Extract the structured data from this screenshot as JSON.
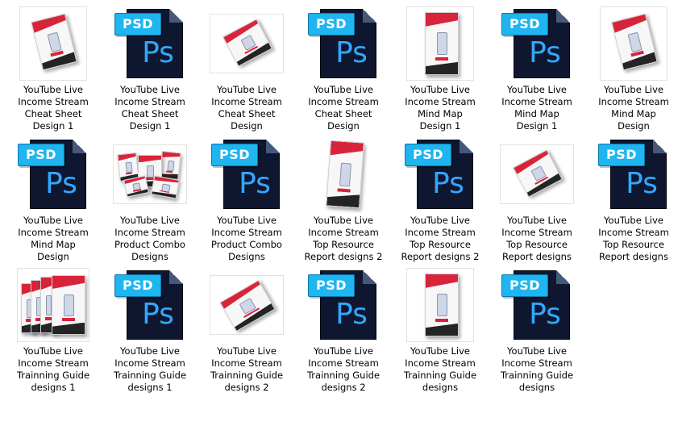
{
  "files": [
    {
      "type": "cover",
      "style": "tilt",
      "label": [
        "YouTube Live",
        "Income Stream",
        "Cheat Sheet",
        "Design 1"
      ]
    },
    {
      "type": "psd",
      "badge": "PSD",
      "mark": "Ps",
      "label": [
        "YouTube Live",
        "Income Stream",
        "Cheat Sheet",
        "Design 1"
      ]
    },
    {
      "type": "cover",
      "style": "flat",
      "label": [
        "YouTube Live",
        "Income Stream",
        "Cheat Sheet",
        "Design"
      ]
    },
    {
      "type": "psd",
      "badge": "PSD",
      "mark": "Ps",
      "label": [
        "YouTube Live",
        "Income Stream",
        "Cheat Sheet",
        "Design"
      ]
    },
    {
      "type": "cover",
      "style": "book",
      "label": [
        "YouTube Live",
        "Income Stream",
        "Mind Map",
        "Design 1"
      ]
    },
    {
      "type": "psd",
      "badge": "PSD",
      "mark": "Ps",
      "label": [
        "YouTube Live",
        "Income Stream",
        "Mind Map",
        "Design 1"
      ]
    },
    {
      "type": "cover",
      "style": "tilt",
      "label": [
        "YouTube Live",
        "Income Stream",
        "Mind Map",
        "Design"
      ]
    },
    {
      "type": "psd",
      "badge": "PSD",
      "mark": "Ps",
      "label": [
        "YouTube Live",
        "Income Stream",
        "Mind Map",
        "Design"
      ]
    },
    {
      "type": "cover",
      "style": "combo",
      "label": [
        "YouTube Live",
        "Income Stream",
        "Product Combo",
        "Designs"
      ]
    },
    {
      "type": "psd",
      "badge": "PSD",
      "mark": "Ps",
      "label": [
        "YouTube Live",
        "Income Stream",
        "Product Combo",
        "Designs"
      ]
    },
    {
      "type": "cover",
      "style": "curl",
      "label": [
        "YouTube Live",
        "Income Stream",
        "Top Resource",
        "Report designs 2"
      ]
    },
    {
      "type": "psd",
      "badge": "PSD",
      "mark": "Ps",
      "label": [
        "YouTube Live",
        "Income Stream",
        "Top Resource",
        "Report designs 2"
      ]
    },
    {
      "type": "cover",
      "style": "flat",
      "label": [
        "YouTube Live",
        "Income Stream",
        "Top Resource",
        "Report designs"
      ]
    },
    {
      "type": "psd",
      "badge": "PSD",
      "mark": "Ps",
      "label": [
        "YouTube Live",
        "Income Stream",
        "Top Resource",
        "Report designs"
      ]
    },
    {
      "type": "cover",
      "style": "boxes",
      "label": [
        "YouTube Live",
        "Income Stream",
        "Trainning Guide",
        "designs 1"
      ]
    },
    {
      "type": "psd",
      "badge": "PSD",
      "mark": "Ps",
      "label": [
        "YouTube Live",
        "Income Stream",
        "Trainning Guide",
        "designs 1"
      ]
    },
    {
      "type": "cover",
      "style": "box",
      "label": [
        "YouTube Live",
        "Income Stream",
        "Trainning Guide",
        "designs 2"
      ]
    },
    {
      "type": "psd",
      "badge": "PSD",
      "mark": "Ps",
      "label": [
        "YouTube Live",
        "Income Stream",
        "Trainning Guide",
        "designs 2"
      ]
    },
    {
      "type": "cover",
      "style": "book",
      "label": [
        "YouTube Live",
        "Income Stream",
        "Trainning Guide",
        "designs"
      ]
    },
    {
      "type": "psd",
      "badge": "PSD",
      "mark": "Ps",
      "label": [
        "YouTube Live",
        "Income Stream",
        "Trainning Guide",
        "designs"
      ]
    }
  ]
}
